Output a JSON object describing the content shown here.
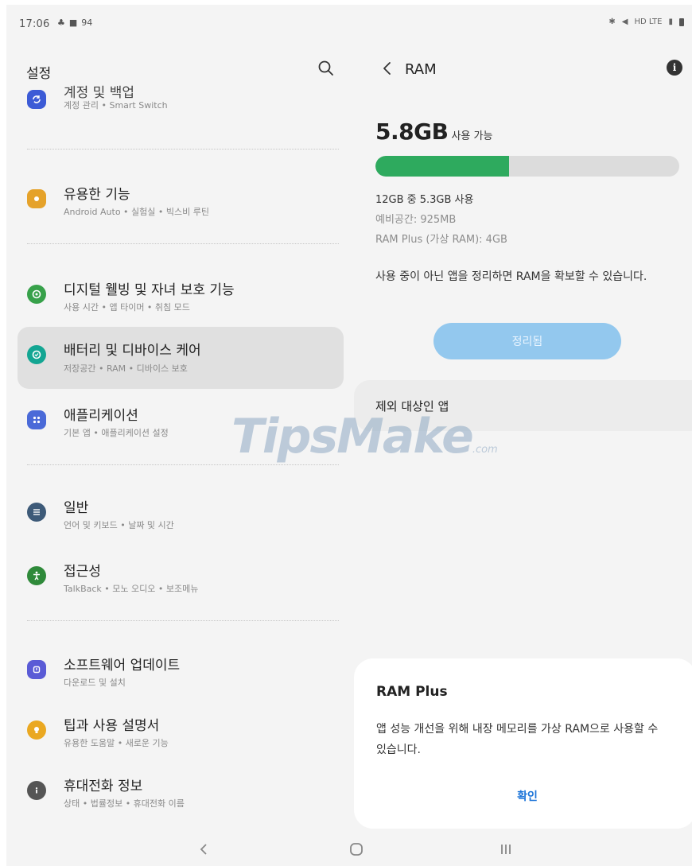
{
  "status_bar": {
    "time": "17:06",
    "left_icons_text": "94",
    "right_icons_text": "HD LTE"
  },
  "settings": {
    "title": "설정",
    "items": [
      {
        "title": "계정 및 백업",
        "subtitle": "계정 관리 • Smart Switch",
        "icon": "sync-icon",
        "color": "#3c5bd6"
      },
      {
        "title": "유용한 기능",
        "subtitle": "Android Auto • 실험실 • 빅스비 루틴",
        "icon": "puzzle-icon",
        "color": "#e5a22a"
      },
      {
        "title": "디지털 웰빙 및 자녀 보호 기능",
        "subtitle": "사용 시간 • 앱 타이머 • 취침 모드",
        "icon": "wellbeing-icon",
        "color": "#37a14a"
      },
      {
        "title": "배터리 및 디바이스 케어",
        "subtitle": "저장공간 • RAM • 디바이스 보호",
        "icon": "device-care-icon",
        "color": "#13a693"
      },
      {
        "title": "애플리케이션",
        "subtitle": "기본 앱 • 애플리케이션 설정",
        "icon": "apps-icon",
        "color": "#4a6ad8"
      },
      {
        "title": "일반",
        "subtitle": "언어 및 키보드 • 날짜 및 시간",
        "icon": "sliders-icon",
        "color": "#3d5a78"
      },
      {
        "title": "접근성",
        "subtitle": "TalkBack • 모노 오디오 • 보조메뉴",
        "icon": "accessibility-icon",
        "color": "#2f8a3a"
      },
      {
        "title": "소프트웨어 업데이트",
        "subtitle": "다운로드 및 설치",
        "icon": "update-icon",
        "color": "#5a5bd6"
      },
      {
        "title": "팁과 사용 설명서",
        "subtitle": "유용한 도움말 • 새로운 기능",
        "icon": "bulb-icon",
        "color": "#eaa821"
      },
      {
        "title": "휴대전화 정보",
        "subtitle": "상태 • 법률정보 • 휴대전화 이름",
        "icon": "info-icon",
        "color": "#555555"
      }
    ]
  },
  "ram": {
    "title": "RAM",
    "available_value": "5.8GB",
    "available_label": "사용 가능",
    "used_fraction": 0.44,
    "bar_color": "#2eaa5e",
    "usage_line": "12GB 중 5.3GB 사용",
    "reserved_line": "예비공간: 925MB",
    "ram_plus_line": "RAM Plus (가상 RAM): 4GB",
    "description": "사용 중이 아닌 앱을 정리하면 RAM을 확보할 수 있습니다.",
    "clean_button": "정리됨",
    "excluded_apps": "제외 대상인 앱"
  },
  "watermark": {
    "main": "TipsMake",
    "suffix": ".com"
  },
  "dialog": {
    "title": "RAM Plus",
    "body": "앱 성능 개선을 위해 내장 메모리를 가상 RAM으로 사용할 수 있습니다.",
    "ok": "확인"
  }
}
